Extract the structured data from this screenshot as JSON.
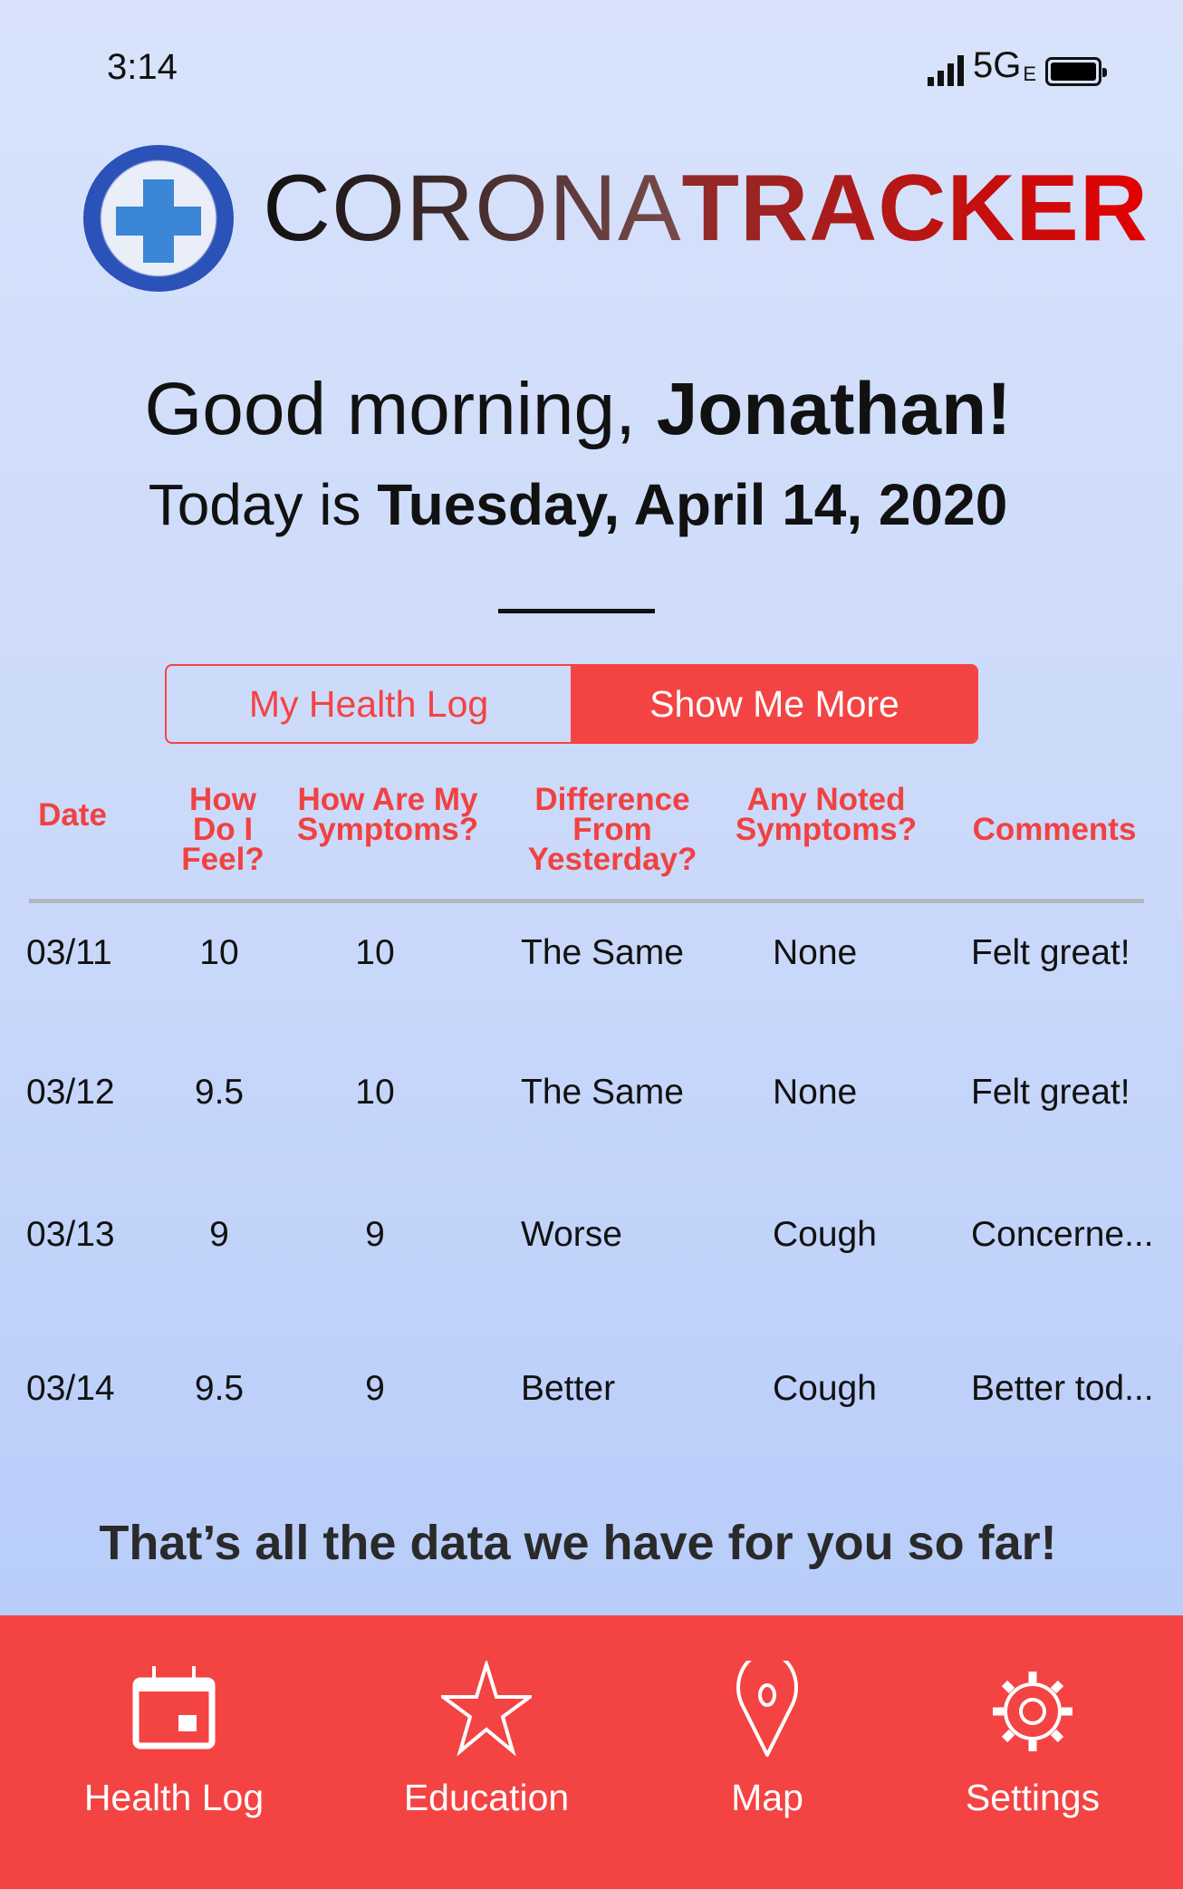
{
  "status_bar": {
    "time": "3:14",
    "network": "5G",
    "network_suffix": "E",
    "battery_level": 1.0
  },
  "logo": {
    "text_regular": "CORONA",
    "text_bold": "TRACKER"
  },
  "greeting": {
    "prefix": "Good morning, ",
    "name": "Jonathan!"
  },
  "date_line": {
    "prefix": "Today is ",
    "date": "Tuesday, April 14, 2020"
  },
  "segmented": {
    "options": [
      "My Health Log",
      "Show Me More"
    ],
    "selected": "Show Me More"
  },
  "table": {
    "headers": [
      "Date",
      "How Do I Feel?",
      "How Are My Symptoms?",
      "Difference From Yesterday?",
      "Any Noted Symptoms?",
      "Comments"
    ],
    "rows": [
      [
        "03/11",
        "10",
        "10",
        "The Same",
        "None",
        "Felt great!"
      ],
      [
        "03/12",
        "9.5",
        "10",
        "The Same",
        "None",
        "Felt great!"
      ],
      [
        "03/13",
        "9",
        "9",
        "Worse",
        "Cough",
        "Concerne..."
      ],
      [
        "03/14",
        "9.5",
        "9",
        "Better",
        "Cough",
        "Better tod..."
      ]
    ]
  },
  "footer_message": "That’s all the data we have for you so far!",
  "tabbar": {
    "items": [
      {
        "label": "Health Log",
        "icon": "calendar-icon"
      },
      {
        "label": "Education",
        "icon": "star-icon"
      },
      {
        "label": "Map",
        "icon": "map-pin-icon"
      },
      {
        "label": "Settings",
        "icon": "gear-icon"
      }
    ]
  },
  "colors": {
    "accent": "#f44343",
    "header_text": "#f04242",
    "background": "#c9d8fa"
  }
}
